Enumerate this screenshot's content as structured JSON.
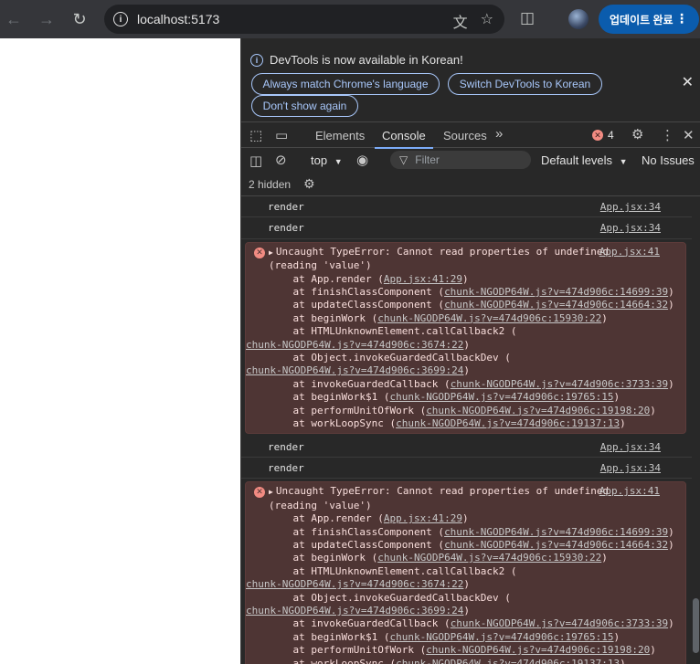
{
  "browser": {
    "url": "localhost:5173",
    "update_label": "업데이트 완료"
  },
  "infobar": {
    "message": "DevTools is now available in Korean!",
    "btn_match": "Always match Chrome's language",
    "btn_switch": "Switch DevTools to Korean",
    "btn_dont_show": "Don't show again"
  },
  "tabs": {
    "elements": "Elements",
    "console": "Console",
    "sources": "Sources",
    "error_count": "4"
  },
  "filterbar": {
    "context": "top",
    "filter_placeholder": "Filter",
    "levels": "Default levels",
    "issues": "No Issues"
  },
  "hidden_label": "2 hidden",
  "log": {
    "render_text": "render",
    "render_src": "App.jsx:34",
    "error_src": "App.jsx:41",
    "error_title": "Uncaught TypeError: Cannot read properties of undefined",
    "error_title2": "(reading 'value')",
    "stack": [
      {
        "indent": "    at App.render (",
        "link": "App.jsx:41:29",
        "tail": ")",
        "wrap": ""
      },
      {
        "indent": "    at finishClassComponent (",
        "link": "chunk-NGODP64W.js?v=474d906c:14699:39",
        "tail": ")",
        "wrap": ""
      },
      {
        "indent": "    at updateClassComponent (",
        "link": "chunk-NGODP64W.js?v=474d906c:14664:32",
        "tail": ")",
        "wrap": ""
      },
      {
        "indent": "    at beginWork (",
        "link": "chunk-NGODP64W.js?v=474d906c:15930:22",
        "tail": ")",
        "wrap": ""
      },
      {
        "indent": "    at HTMLUnknownElement.callCallback2 (",
        "link": "",
        "tail": "",
        "wrap": "chunk-NGODP64W.js?v=474d906c:3674:22"
      },
      {
        "indent": "    at Object.invokeGuardedCallbackDev (",
        "link": "",
        "tail": "",
        "wrap": "chunk-NGODP64W.js?v=474d906c:3699:24"
      },
      {
        "indent": "    at invokeGuardedCallback (",
        "link": "chunk-NGODP64W.js?v=474d906c:3733:39",
        "tail": ")",
        "wrap": ""
      },
      {
        "indent": "    at beginWork$1 (",
        "link": "chunk-NGODP64W.js?v=474d906c:19765:15",
        "tail": ")",
        "wrap": ""
      },
      {
        "indent": "    at performUnitOfWork (",
        "link": "chunk-NGODP64W.js?v=474d906c:19198:20",
        "tail": ")",
        "wrap": ""
      },
      {
        "indent": "    at workLoopSync (",
        "link": "chunk-NGODP64W.js?v=474d906c:19137:13",
        "tail": ")",
        "wrap": ""
      }
    ]
  },
  "colors": {
    "error_bg": "#4e3534",
    "error_icon": "#f28b82",
    "accent": "#7cacf8",
    "update_btn": "#0b5cad"
  },
  "icons": [
    "back-icon",
    "forward-icon",
    "reload-icon",
    "info-icon",
    "translate-icon",
    "star-icon",
    "extensions-icon",
    "inspect-icon",
    "device-icon",
    "more-tabs-icon",
    "settings-icon",
    "kebab-icon",
    "close-icon",
    "sidebar-icon",
    "clear-icon",
    "eye-icon",
    "filter-icon",
    "gear-icon",
    "error-icon"
  ]
}
